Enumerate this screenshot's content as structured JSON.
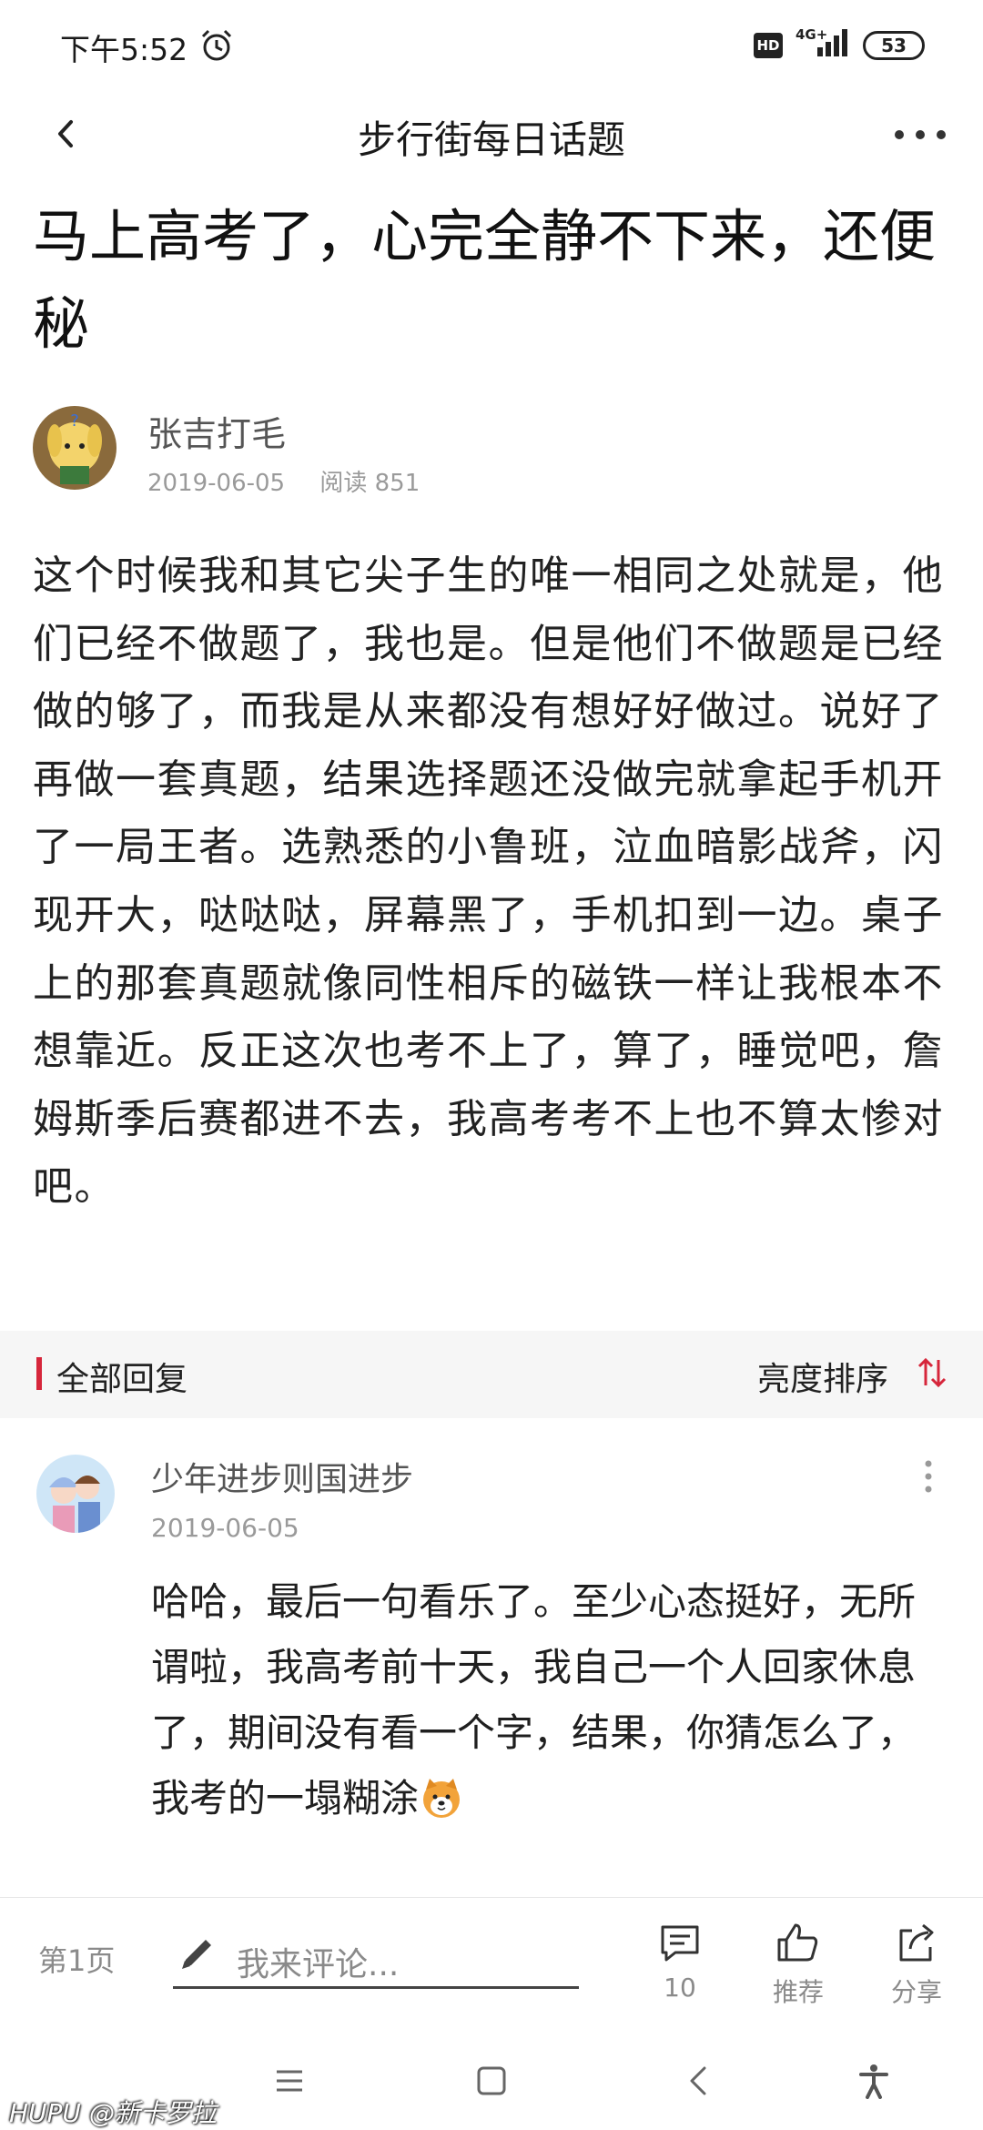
{
  "status_bar": {
    "time": "下午5:52",
    "hd_label": "HD",
    "network": "4G+",
    "battery": "53"
  },
  "nav": {
    "title": "步行街每日话题"
  },
  "post": {
    "title": "马上高考了，心完全静不下来，还便秘",
    "author": "张吉打毛",
    "date": "2019-06-05",
    "reads": "阅读 851",
    "body": "这个时候我和其它尖子生的唯一相同之处就是，他们已经不做题了，我也是。但是他们不做题是已经做的够了，而我是从来都没有想好好做过。说好了再做一套真题，结果选择题还没做完就拿起手机开了一局王者。选熟悉的小鲁班，泣血暗影战斧，闪现开大，哒哒哒，屏幕黑了，手机扣到一边。桌子上的那套真题就像同性相斥的磁铁一样让我根本不想靠近。反正这次也考不上了，算了，睡觉吧，詹姆斯季后赛都进不去，我高考考不上也不算太惨对吧。"
  },
  "replies": {
    "title": "全部回复",
    "sort_label": "亮度排序",
    "items": [
      {
        "user": "少年进步则国进步",
        "date": "2019-06-05",
        "text": "哈哈，最后一句看乐了。至少心态挺好，无所谓啦，我高考前十天，我自己一个人回家休息了，期间没有看一个字，结果，你猜怎么了，我考的一塌糊涂"
      }
    ]
  },
  "bottom_bar": {
    "page": "第1页",
    "comment_placeholder": "我来评论...",
    "comments_count": "10",
    "recommend_label": "推荐",
    "share_label": "分享"
  },
  "watermark": "HUPU @新卡罗拉",
  "colors": {
    "accent": "#d6263b",
    "secondary_text": "#9a9a9a"
  },
  "icons": [
    "alarm-icon",
    "signal-icon",
    "back-icon",
    "more-icon",
    "sort-icon",
    "pencil-icon",
    "comment-icon",
    "thumbs-up-icon",
    "share-icon",
    "menu-icon",
    "home-icon",
    "back-nav-icon",
    "accessibility-icon"
  ]
}
